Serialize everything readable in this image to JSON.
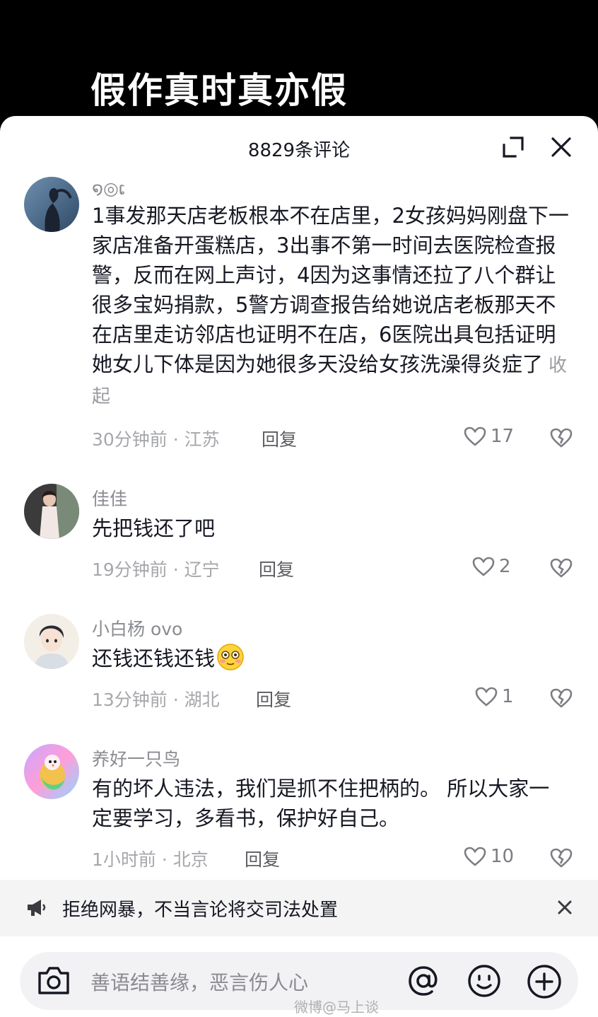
{
  "video": {
    "title": "假作真时真亦假"
  },
  "header": {
    "comment_count": "8829条评论"
  },
  "comments": [
    {
      "username": "໑◎ເ",
      "text": "1事发那天店老板根本不在店里，2女孩妈妈刚盘下一家店准备开蛋糕店，3出事不第一时间去医院检查报警，反而在网上声讨，4因为这事情还拉了八个群让很多宝妈捐款，5警方调查报告给她说店老板那天不在店里走访邻店也证明不在店，6医院出具包括证明她女儿下体是因为她很多天没给女孩洗澡得炎症了",
      "collapse_label": "收起",
      "time_location": "30分钟前 · 江苏",
      "reply_label": "回复",
      "likes": "17"
    },
    {
      "username": "佳佳",
      "text": "先把钱还了吧",
      "time_location": "19分钟前 · 辽宁",
      "reply_label": "回复",
      "likes": "2"
    },
    {
      "username": "小白杨 ovo",
      "text": "还钱还钱还钱",
      "emoji": "flushed-face-emoji",
      "time_location": "13分钟前 · 湖北",
      "reply_label": "回复",
      "likes": "1"
    },
    {
      "username": "养好一只鸟",
      "text": "有的坏人违法，我们是抓不住把柄的。 所以大家一定要学习，多看书，保护好自己。",
      "time_location": "1小时前 · 北京",
      "reply_label": "回复",
      "likes": "10"
    }
  ],
  "notice": {
    "text": "拒绝网暴，不当言论将交司法处置"
  },
  "input": {
    "placeholder": "善语结善缘，恶言伤人心"
  },
  "watermark": "微博@马上谈",
  "icons": {
    "expand": "expand-icon",
    "close": "close-icon",
    "like": "heart-icon",
    "dislike": "broken-heart-icon",
    "megaphone": "megaphone-icon",
    "camera": "camera-icon",
    "mention": "at-icon",
    "emoji": "smile-icon",
    "add": "plus-icon"
  },
  "colors": {
    "background": "#000000",
    "sheet": "#ffffff",
    "text_primary": "#161823",
    "text_secondary": "#8a8b91",
    "notice_bg": "#f4f4f4"
  }
}
